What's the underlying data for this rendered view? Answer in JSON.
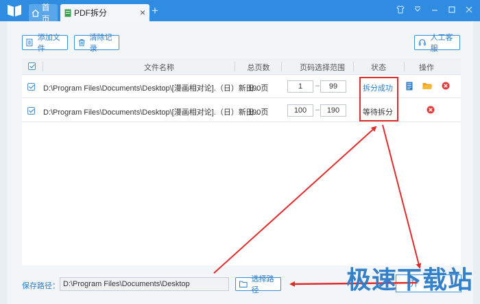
{
  "titlebar": {
    "tabs": [
      {
        "label": "首页"
      },
      {
        "label": "PDF拆分"
      }
    ],
    "tab_close": "×",
    "tab_add": "+",
    "window_buttons": [
      "shirt-icon",
      "menu-icon",
      "minimize-icon",
      "maximize-icon",
      "close-icon"
    ]
  },
  "toolbar": {
    "add_file": "添加文件",
    "clear_records": "清除记录",
    "customer_service": "人工客服"
  },
  "table": {
    "headers": [
      "文件名称",
      "总页数",
      "页码选择范围",
      "状态",
      "操作"
    ],
    "rows": [
      {
        "file": "D:\\Program Files\\Documents\\Desktop\\[漫画相对论].（日）新田...",
        "pages": "190页",
        "from": "1",
        "to": "99",
        "status": "拆分成功"
      },
      {
        "file": "D:\\Program Files\\Documents\\Desktop\\[漫画相对论].（日）新田...",
        "pages": "190页",
        "from": "100",
        "to": "190",
        "status": "等待拆分"
      }
    ],
    "range_sep": "–"
  },
  "footer": {
    "save_label": "保存路径：",
    "save_path": "D:\\Program Files\\Documents\\Desktop",
    "choose_path": "选择路径",
    "start": "开"
  },
  "watermark": "极速下载站",
  "colors": {
    "titlebar": "#2f8ce0",
    "accent": "#2a7bc8",
    "highlight": "#e02b2b"
  }
}
